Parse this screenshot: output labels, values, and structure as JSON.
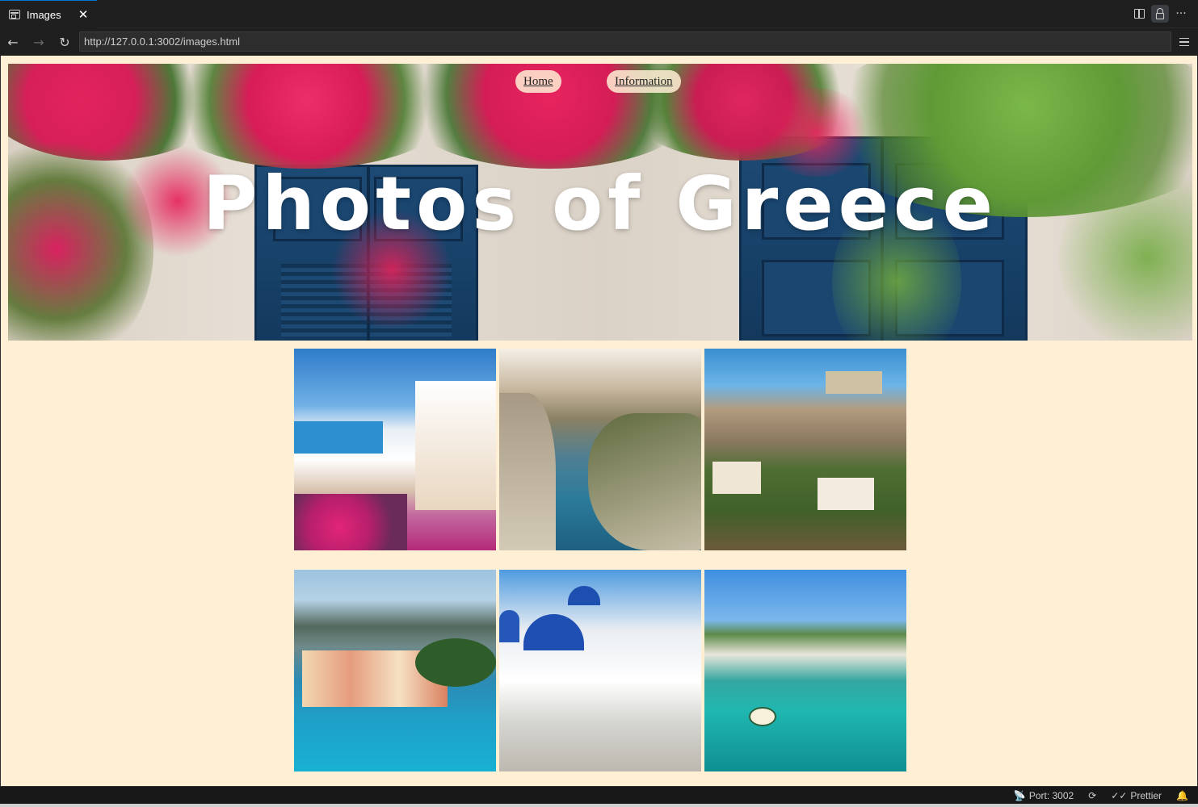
{
  "tab": {
    "title": "Images",
    "close_icon": "close-icon"
  },
  "toolbar": {
    "back": "←",
    "forward": "→",
    "reload": "↻"
  },
  "address": {
    "url": "http://127.0.0.1:3002/images.html"
  },
  "page": {
    "nav": [
      {
        "label": "Home"
      },
      {
        "label": "Information"
      }
    ],
    "title": "Photos of Greece",
    "photos": [
      {
        "subject": "Santorini whitewashed village with flowers"
      },
      {
        "subject": "Navagio bay aerial view"
      },
      {
        "subject": "Acropolis hill in Athens"
      },
      {
        "subject": "Assos village on Kefalonia coast"
      },
      {
        "subject": "Blue-domed church in Oia"
      },
      {
        "subject": "Turquoise harbor with small boat"
      }
    ]
  },
  "status": {
    "port": "Port: 3002",
    "prettier": "Prettier"
  },
  "colors": {
    "page_bg": "#ffefd5",
    "chrome_bg": "#1f1f1f",
    "accent": "#0078d4",
    "door_blue": "#1d4a74",
    "bougainvillea": "#e5245f"
  }
}
